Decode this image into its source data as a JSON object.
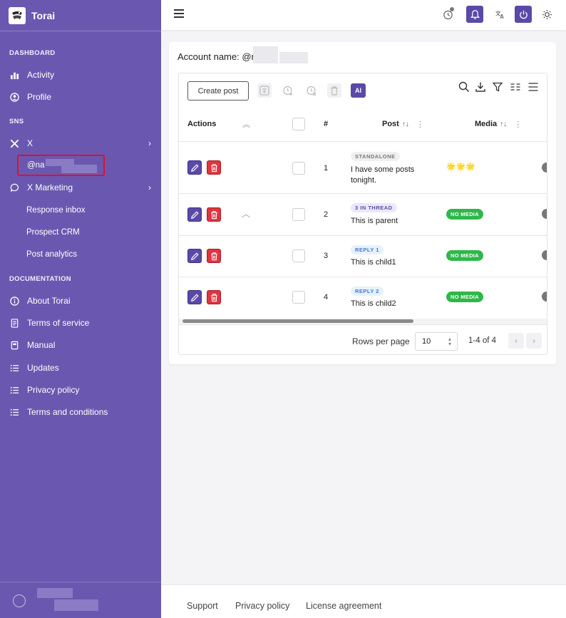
{
  "app": {
    "name": "Torai"
  },
  "sidebar": {
    "sections": {
      "dashboard": "DASHBOARD",
      "sns": "SNS",
      "documentation": "DOCUMENTATION"
    },
    "dashboard_items": [
      {
        "label": "Activity",
        "icon": "bar-chart-icon"
      },
      {
        "label": "Profile",
        "icon": "user-circle-icon"
      }
    ],
    "sns_items": [
      {
        "label": "X",
        "icon": "x-logo-icon"
      },
      {
        "label": "X Marketing",
        "icon": "chat-bubble-icon"
      }
    ],
    "x_account": "@na",
    "marketing_sub": [
      "Response inbox",
      "Prospect CRM",
      "Post analytics"
    ],
    "doc_items": [
      {
        "label": "About Torai",
        "icon": "info-icon"
      },
      {
        "label": "Terms of service",
        "icon": "document-icon"
      },
      {
        "label": "Manual",
        "icon": "book-icon"
      },
      {
        "label": "Updates",
        "icon": "list-icon"
      },
      {
        "label": "Privacy policy",
        "icon": "list-icon"
      },
      {
        "label": "Terms and conditions",
        "icon": "list-icon"
      }
    ]
  },
  "main": {
    "account_label": "Account name: @n",
    "toolbar": {
      "create_post": "Create post",
      "ai": "AI"
    },
    "columns": {
      "actions": "Actions",
      "number": "#",
      "post": "Post",
      "media": "Media",
      "sort_icon": "↑↓",
      "more_icon": "⋮"
    },
    "rows": [
      {
        "num": "1",
        "tag": "STANDALONE",
        "text": "I have some posts tonight.",
        "media": "🌟🌟🌟"
      },
      {
        "num": "2",
        "tag": "3 IN THREAD",
        "text": "This is parent",
        "media": "NO MEDIA"
      },
      {
        "num": "3",
        "tag": "REPLY 1",
        "text": "This is child1",
        "media": "NO MEDIA"
      },
      {
        "num": "4",
        "tag": "REPLY 2",
        "text": "This is child2",
        "media": "NO MEDIA"
      }
    ],
    "pagination": {
      "rows_per_page_label": "Rows per page",
      "rows_per_page": "10",
      "range": "1-4 of 4"
    }
  },
  "footer": {
    "support": "Support",
    "privacy": "Privacy policy",
    "license": "License agreement"
  },
  "colors": {
    "sidebar": "#6a58b0",
    "accent": "#5b49a8",
    "delete": "#e0353f",
    "success": "#2eb84a"
  }
}
